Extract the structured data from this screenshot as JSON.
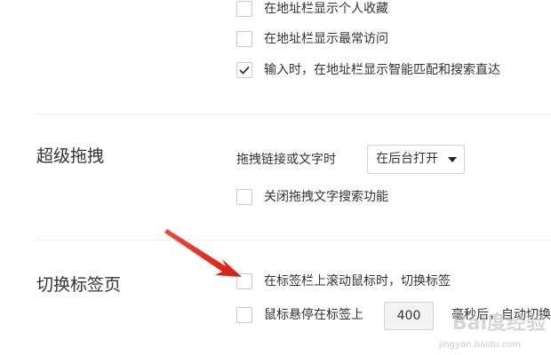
{
  "address_bar_options": [
    {
      "label": "在地址栏显示个人收藏",
      "checked": false
    },
    {
      "label": "在地址栏显示最常访问",
      "checked": false
    },
    {
      "label": "输入时，在地址栏显示智能匹配和搜索直达",
      "checked": true
    }
  ],
  "super_drag": {
    "title": "超级拖拽",
    "drag_label": "拖拽链接或文字时",
    "drag_select_value": "在后台打开",
    "disable_search_label": "关闭拖拽文字搜索功能",
    "disable_search_checked": false
  },
  "tab_switch": {
    "title": "切换标签页",
    "scroll_label": "在标签栏上滚动鼠标时，切换标签",
    "scroll_checked": false,
    "hover_label": "鼠标悬停在标签上",
    "hover_value": "400",
    "hover_suffix": "毫秒后，自动切换",
    "hover_checked": false
  },
  "watermark": {
    "text": "Bai度经验",
    "url": "jingyan.baidu.com"
  },
  "colors": {
    "check_mark": "#333333",
    "arrow": "#e8261d"
  }
}
